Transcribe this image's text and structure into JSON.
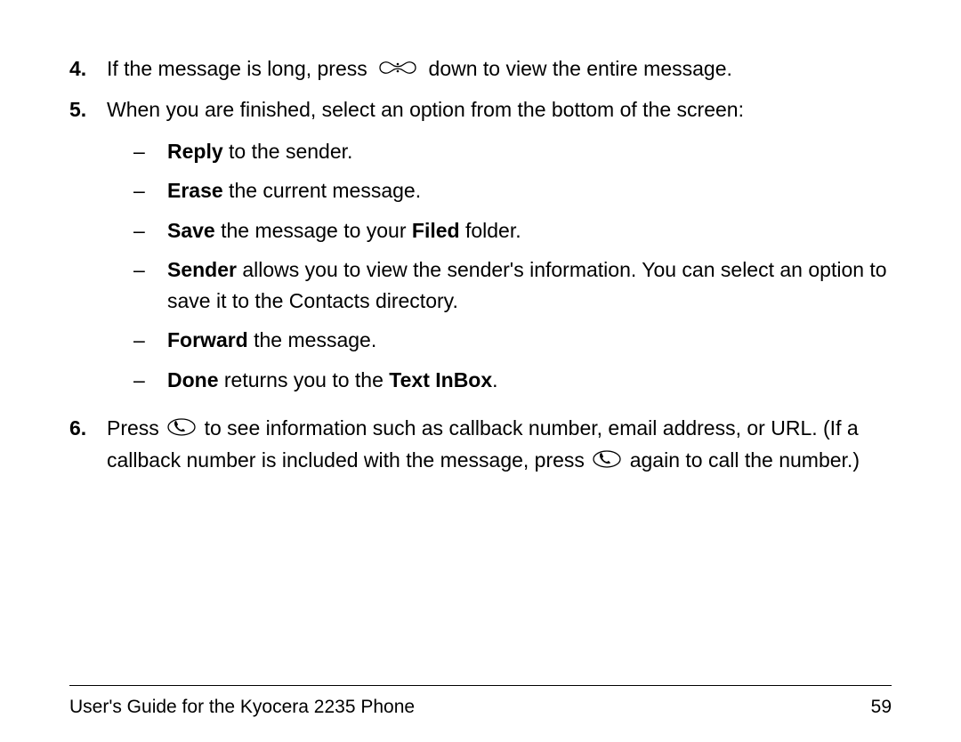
{
  "steps": [
    {
      "num": "4.",
      "segments": [
        {
          "text": "If the message is long, press "
        },
        {
          "icon": "nav"
        },
        {
          "text": " down to view the entire message."
        }
      ]
    },
    {
      "num": "5.",
      "segments": [
        {
          "text": "When you are finished, select an option from the bottom of the screen:"
        }
      ],
      "subs": [
        [
          {
            "bold": "Reply"
          },
          {
            "text": " to the sender."
          }
        ],
        [
          {
            "bold": "Erase"
          },
          {
            "text": " the current message."
          }
        ],
        [
          {
            "bold": "Save"
          },
          {
            "text": " the message to your "
          },
          {
            "bold": "Filed"
          },
          {
            "text": " folder."
          }
        ],
        [
          {
            "bold": "Sender"
          },
          {
            "text": " allows you to view the sender's information. You can select an option to save it to the Contacts directory."
          }
        ],
        [
          {
            "bold": "Forward"
          },
          {
            "text": " the message."
          }
        ],
        [
          {
            "bold": "Done"
          },
          {
            "text": " returns you to the "
          },
          {
            "bold": "Text InBox"
          },
          {
            "text": "."
          }
        ]
      ]
    },
    {
      "num": "6.",
      "segments": [
        {
          "text": "Press "
        },
        {
          "icon": "phone"
        },
        {
          "text": " to see information such as callback number, email address, or URL. (If a callback number is included with the message, press "
        },
        {
          "icon": "phone"
        },
        {
          "text": " again to call the number.)"
        }
      ]
    }
  ],
  "footer": {
    "title": "User's Guide for the Kyocera 2235 Phone",
    "page": "59"
  },
  "dash": "–"
}
